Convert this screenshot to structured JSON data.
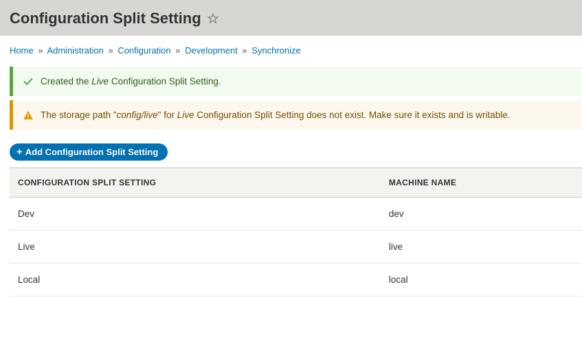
{
  "page": {
    "title": "Configuration Split Setting"
  },
  "breadcrumb": {
    "items": [
      {
        "label": "Home"
      },
      {
        "label": "Administration"
      },
      {
        "label": "Configuration"
      },
      {
        "label": "Development"
      },
      {
        "label": "Synchronize"
      }
    ],
    "separator": "»"
  },
  "messages": {
    "success": {
      "prefix": "Created the ",
      "emphasis": "Live",
      "suffix": " Configuration Split Setting."
    },
    "warning": {
      "p1": "The storage path \"",
      "em1": "config/live",
      "p2": "\" for ",
      "em2": "Live",
      "p3": " Configuration Split Setting does not exist. Make sure it exists and is writable."
    }
  },
  "actions": {
    "add_label": "Add Configuration Split Setting"
  },
  "table": {
    "headers": {
      "col1": "CONFIGURATION SPLIT SETTING",
      "col2": "MACHINE NAME"
    },
    "rows": [
      {
        "name": "Dev",
        "machine": "dev"
      },
      {
        "name": "Live",
        "machine": "live"
      },
      {
        "name": "Local",
        "machine": "local"
      }
    ]
  }
}
